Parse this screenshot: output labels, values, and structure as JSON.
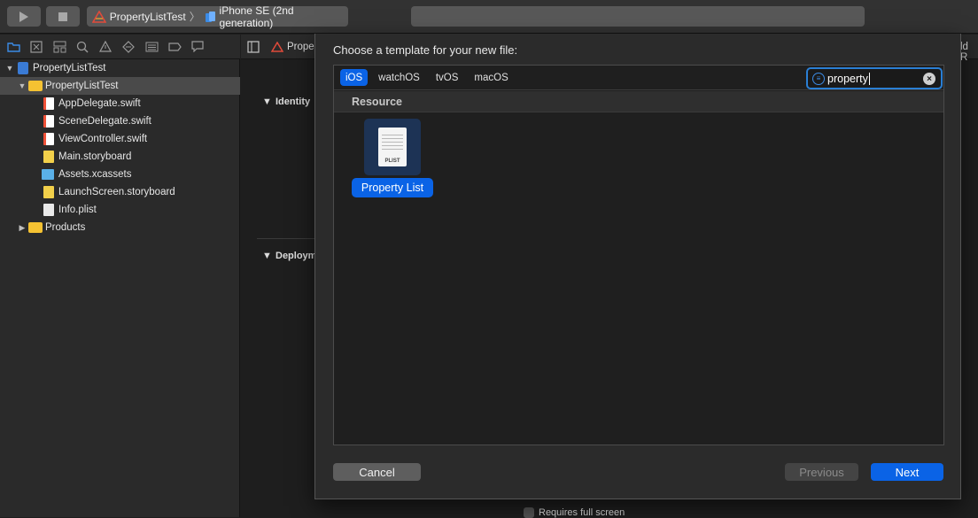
{
  "toolbar": {
    "scheme_project": "PropertyListTest",
    "scheme_device": "iPhone SE (2nd generation)"
  },
  "navigator": {
    "icons": [
      "folder-icon",
      "source-control-icon",
      "hierarchy-icon",
      "find-icon",
      "issue-icon",
      "test-icon",
      "debug-icon",
      "breakpoint-icon",
      "report-icon"
    ],
    "tree": [
      {
        "label": "PropertyListTest",
        "kind": "project",
        "depth": 0,
        "expanded": true
      },
      {
        "label": "PropertyListTest",
        "kind": "folder",
        "depth": 1,
        "expanded": true,
        "selected": true
      },
      {
        "label": "AppDelegate.swift",
        "kind": "swift",
        "depth": 2
      },
      {
        "label": "SceneDelegate.swift",
        "kind": "swift",
        "depth": 2
      },
      {
        "label": "ViewController.swift",
        "kind": "swift",
        "depth": 2
      },
      {
        "label": "Main.storyboard",
        "kind": "storyboard",
        "depth": 2
      },
      {
        "label": "Assets.xcassets",
        "kind": "assets",
        "depth": 2
      },
      {
        "label": "LaunchScreen.storyboard",
        "kind": "storyboard",
        "depth": 2
      },
      {
        "label": "Info.plist",
        "kind": "plist",
        "depth": 2
      },
      {
        "label": "Products",
        "kind": "folder",
        "depth": 1,
        "expanded": false
      }
    ]
  },
  "editor": {
    "jump_item": "Prope",
    "jump_right": "ld R",
    "section_identity": "Identity",
    "section_deployment": "Deploym",
    "requires_full_screen": "Requires full screen"
  },
  "dialog": {
    "title": "Choose a template for your new file:",
    "platform_tabs": [
      "iOS",
      "watchOS",
      "tvOS",
      "macOS"
    ],
    "active_tab": "iOS",
    "search_value": "property",
    "section_header": "Resource",
    "template": {
      "label": "Property List",
      "icon_text": "PLIST"
    },
    "cancel_label": "Cancel",
    "previous_label": "Previous",
    "next_label": "Next"
  },
  "colors": {
    "accent": "#0a63e6",
    "window_bg": "#1e1e1e",
    "sidebar_bg": "#2a2a2a"
  }
}
